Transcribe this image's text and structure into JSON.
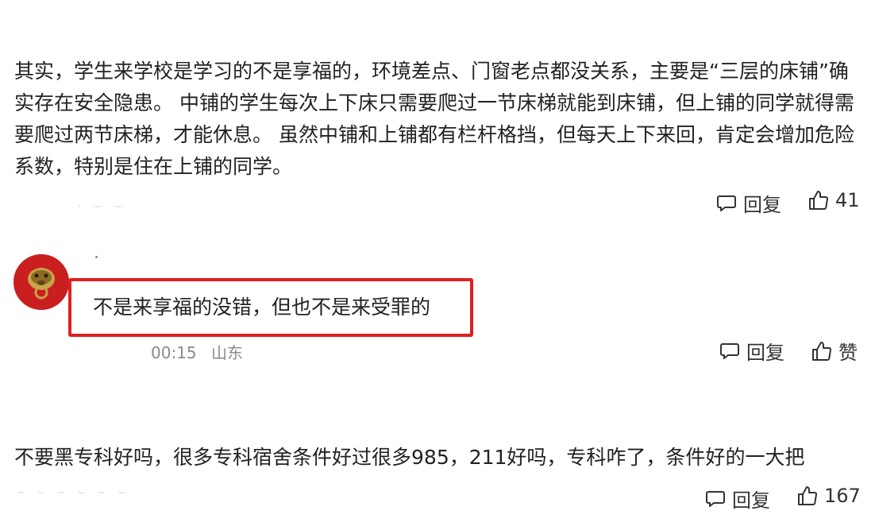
{
  "comments": [
    {
      "text": "其实，学生来学校是学习的不是享福的，环境差点、门窗老点都没关系，主要是“三层的床铺”确实存在安全隐患。 中铺的学生每次上下床只需要爬过一节床梯就能到床铺，但上铺的同学就得需要爬过两节床梯，才能休息。 虽然中铺和上铺都有栏杆格挡，但每天上下来回，肯定会增加危险系数，特别是住在上铺的同学。",
      "reply_label": "回复",
      "like_count": "41"
    },
    {
      "text": "不是来享福的没错，但也不是来受罪的",
      "time": "00:15",
      "location": "山东",
      "reply_label": "回复",
      "like_label": "赞",
      "avatar_color": "#c91f1f",
      "highlight_color": "#e02020"
    },
    {
      "text": "不要黑专科好吗，很多专科宿舍条件好过很多985，211好吗，专科咋了，条件好的一大把",
      "reply_label": "回复",
      "like_count": "167"
    }
  ],
  "icons": {
    "reply": "comment-bubble-icon",
    "like": "thumbs-up-icon"
  }
}
